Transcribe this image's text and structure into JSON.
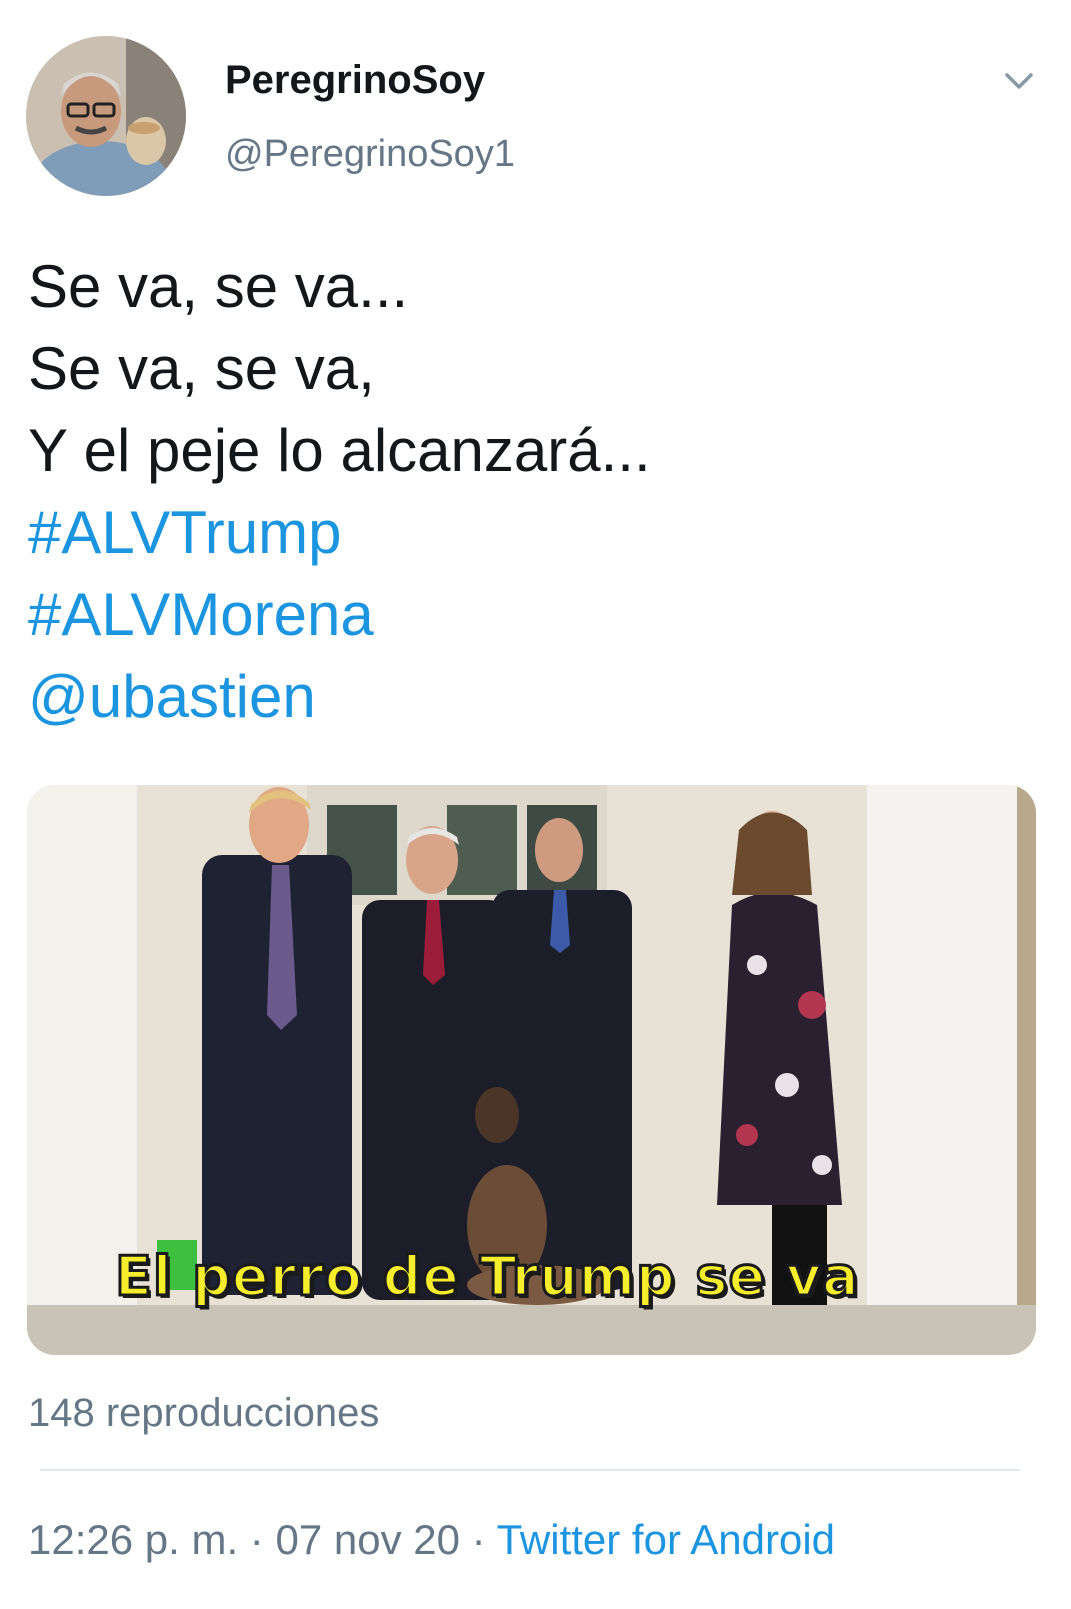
{
  "author": {
    "display_name": "PeregrinoSoy",
    "handle": "@PeregrinoSoy1"
  },
  "tweet": {
    "lines": [
      "Se va, se va...",
      "Se va, se va,",
      "Y el peje lo alcanzará..."
    ],
    "hashtags": [
      "#ALVTrump",
      "#ALVMorena"
    ],
    "mention": "@ubastien"
  },
  "media": {
    "caption": "El perro de Trump se va",
    "views": "148 reproducciones"
  },
  "footer": {
    "time": "12:26 p. m.",
    "separator": "·",
    "date": "07 nov 20",
    "source": "Twitter for Android"
  },
  "colors": {
    "link": "#1b95e0",
    "secondary_text": "#657786",
    "caption": "#f6ee2d"
  },
  "icons": {
    "menu": "chevron-down-icon"
  }
}
